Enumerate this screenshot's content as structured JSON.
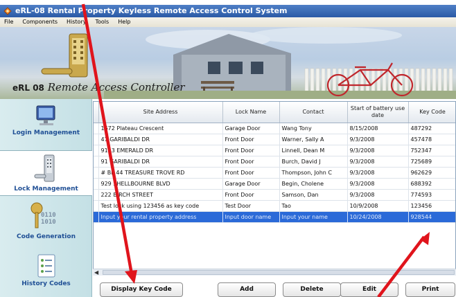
{
  "window": {
    "title": "eRL-08 Rental Property Keyless Remote Access Control System"
  },
  "menu": {
    "items": [
      {
        "label": "File"
      },
      {
        "label": "Components"
      },
      {
        "label": "History"
      },
      {
        "label": "Tools"
      },
      {
        "label": "Help"
      }
    ]
  },
  "banner": {
    "model": "eRL 08",
    "tagline": "Remote Access Controller"
  },
  "sidebar": {
    "items": [
      {
        "label": "Login Management",
        "icon": "computer-monitor-icon"
      },
      {
        "label": "Lock Management",
        "icon": "keypad-lock-icon",
        "active": true
      },
      {
        "label": "Code Generation",
        "icon": "key-binary-icon"
      },
      {
        "label": "History Codes",
        "icon": "history-list-icon"
      }
    ]
  },
  "grid": {
    "columns": [
      "Site Address",
      "Lock Name",
      "Contact",
      "Start of battery use date",
      "Key Code"
    ],
    "rows": [
      [
        "1672 Plateau Crescent",
        "Garage Door",
        "Wang Tony",
        "8/15/2008",
        "487292"
      ],
      [
        "47 GARIBALDI DR",
        "Front Door",
        "Warner, Sally A",
        "9/3/2008",
        "457478"
      ],
      [
        "9143 EMERALD DR",
        "Front Door",
        "Linnell, Dean M",
        "9/3/2008",
        "752347"
      ],
      [
        "91 GARIBALDI DR",
        "Front Door",
        "Burch, David J",
        "9/3/2008",
        "725689"
      ],
      [
        "# BL 44 TREASURE TROVE RD",
        "Front Door",
        "Thompson, John C",
        "9/3/2008",
        "962629"
      ],
      [
        "929 SHELLBOURNE BLVD",
        "Garage Door",
        "Begin, Cholene",
        "9/3/2008",
        "688392"
      ],
      [
        "222 BIRCH STREET",
        "Front Door",
        "Samson, Dan",
        "9/3/2008",
        "774593"
      ],
      [
        "Test lock using 123456 as key code",
        "Test Door",
        "Tao",
        "10/9/2008",
        "123456"
      ],
      [
        "Input your rental property address",
        "Input door name",
        "Input your name",
        "10/24/2008",
        "928544"
      ]
    ],
    "selected_row": 8
  },
  "buttons": {
    "display_key_code": "Display Key Code",
    "add": "Add",
    "delete": "Delete",
    "edit": "Edit",
    "print": "Print"
  },
  "colors": {
    "selection": "#2b6ad8",
    "annotation_arrow": "#e0141c",
    "sidebar_text": "#1f4f95"
  }
}
